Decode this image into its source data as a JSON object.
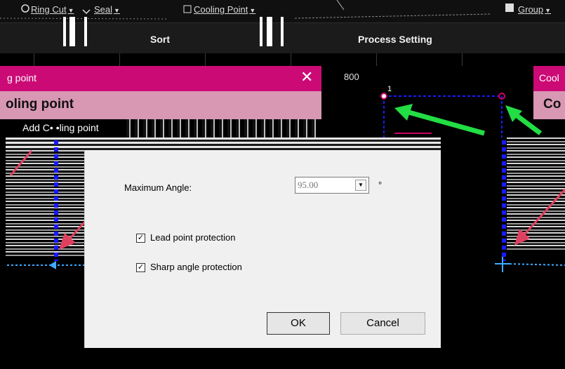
{
  "toolbar": {
    "items": [
      {
        "icon": "ring-cut-icon",
        "label": "Ring Cut",
        "dropdown": "▼"
      },
      {
        "icon": "seal-icon",
        "label": "Seal",
        "dropdown": "▼"
      },
      {
        "icon": "cooling-point-icon",
        "label": "Cooling Point",
        "dropdown": "▼"
      },
      {
        "icon": "group-icon",
        "label": "Group",
        "dropdown": "▼"
      }
    ],
    "ribbon": {
      "sort_label": "Sort",
      "process_setting_label": "Process Setting"
    }
  },
  "left_dialog": {
    "title": "g point",
    "close": "✕",
    "heading": "oling point",
    "subtext": "Add C• •ling point"
  },
  "right_dialog": {
    "title": "Cool",
    "heading": "Co"
  },
  "canvas": {
    "label": "800",
    "point_number": "1",
    "colors": {
      "path": "#1a1aff",
      "arrow": "#22dd44",
      "marker": "#cc0066",
      "crosshair": "#3fa9ff"
    }
  },
  "dialog": {
    "max_angle_label": "Maximum Angle:",
    "max_angle_value": "95.00",
    "angle_unit": "°",
    "lead_point_protection": {
      "label": "Lead point protection",
      "checked": true
    },
    "sharp_angle_protection": {
      "label": "Sharp angle protection",
      "checked": true
    },
    "ok_label": "OK",
    "cancel_label": "Cancel"
  },
  "colors": {
    "title_bar": "#cc0a76",
    "dialog_bg": "#f0f0f0",
    "background": "#000000"
  }
}
